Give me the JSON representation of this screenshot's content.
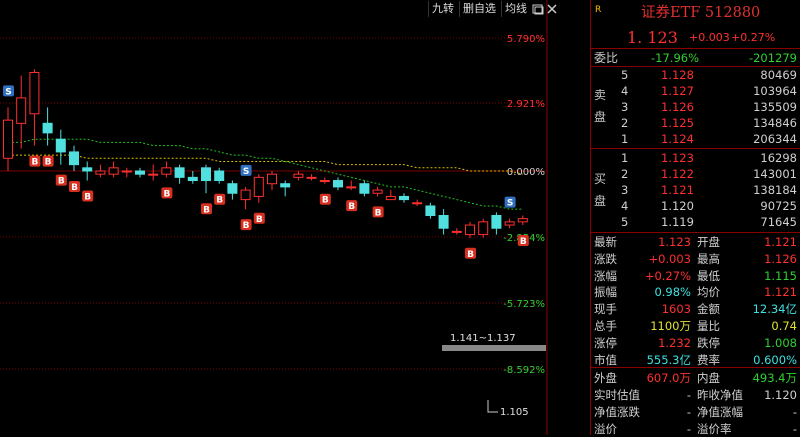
{
  "toolbar": {
    "items": [
      "九转",
      "删自选",
      "均线"
    ]
  },
  "chart_data": {
    "type": "candlestick",
    "title": "",
    "y_axis_right_labels": [
      "5.790%",
      "2.921%",
      "0.000%",
      "-2.854%",
      "-5.723%",
      "-8.592%"
    ],
    "base_price": 1.12,
    "candles": [
      {
        "o": 1.124,
        "c": 1.136,
        "h": 1.14,
        "l": 1.12
      },
      {
        "o": 1.135,
        "c": 1.143,
        "h": 1.15,
        "l": 1.127
      },
      {
        "o": 1.138,
        "c": 1.151,
        "h": 1.152,
        "l": 1.128
      },
      {
        "o": 1.135,
        "c": 1.132,
        "h": 1.14,
        "l": 1.128
      },
      {
        "o": 1.13,
        "c": 1.126,
        "h": 1.133,
        "l": 1.122
      },
      {
        "o": 1.126,
        "c": 1.122,
        "h": 1.128,
        "l": 1.12
      },
      {
        "o": 1.121,
        "c": 1.12,
        "h": 1.123,
        "l": 1.117
      },
      {
        "o": 1.119,
        "c": 1.12,
        "h": 1.122,
        "l": 1.118
      },
      {
        "o": 1.119,
        "c": 1.121,
        "h": 1.123,
        "l": 1.118
      },
      {
        "o": 1.12,
        "c": 1.12,
        "h": 1.121,
        "l": 1.118
      },
      {
        "o": 1.12,
        "c": 1.119,
        "h": 1.121,
        "l": 1.118
      },
      {
        "o": 1.119,
        "c": 1.119,
        "h": 1.122,
        "l": 1.117
      },
      {
        "o": 1.119,
        "c": 1.121,
        "h": 1.123,
        "l": 1.118
      },
      {
        "o": 1.121,
        "c": 1.118,
        "h": 1.122,
        "l": 1.116
      },
      {
        "o": 1.118,
        "c": 1.117,
        "h": 1.12,
        "l": 1.116
      },
      {
        "o": 1.121,
        "c": 1.117,
        "h": 1.122,
        "l": 1.113
      },
      {
        "o": 1.12,
        "c": 1.117,
        "h": 1.121,
        "l": 1.116
      },
      {
        "o": 1.116,
        "c": 1.113,
        "h": 1.117,
        "l": 1.111
      },
      {
        "o": 1.111,
        "c": 1.114,
        "h": 1.115,
        "l": 1.108
      },
      {
        "o": 1.112,
        "c": 1.118,
        "h": 1.119,
        "l": 1.11
      },
      {
        "o": 1.116,
        "c": 1.119,
        "h": 1.12,
        "l": 1.114
      },
      {
        "o": 1.116,
        "c": 1.115,
        "h": 1.117,
        "l": 1.112
      },
      {
        "o": 1.118,
        "c": 1.119,
        "h": 1.12,
        "l": 1.117
      },
      {
        "o": 1.118,
        "c": 1.118,
        "h": 1.119,
        "l": 1.117
      },
      {
        "o": 1.117,
        "c": 1.117,
        "h": 1.118,
        "l": 1.116
      },
      {
        "o": 1.117,
        "c": 1.115,
        "h": 1.118,
        "l": 1.114
      },
      {
        "o": 1.115,
        "c": 1.115,
        "h": 1.117,
        "l": 1.114
      },
      {
        "o": 1.116,
        "c": 1.113,
        "h": 1.117,
        "l": 1.112
      },
      {
        "o": 1.113,
        "c": 1.114,
        "h": 1.115,
        "l": 1.112
      },
      {
        "o": 1.111,
        "c": 1.112,
        "h": 1.114,
        "l": 1.111
      },
      {
        "o": 1.112,
        "c": 1.111,
        "h": 1.113,
        "l": 1.11
      },
      {
        "o": 1.11,
        "c": 1.11,
        "h": 1.111,
        "l": 1.109
      },
      {
        "o": 1.109,
        "c": 1.106,
        "h": 1.11,
        "l": 1.105
      },
      {
        "o": 1.106,
        "c": 1.102,
        "h": 1.108,
        "l": 1.1
      },
      {
        "o": 1.101,
        "c": 1.101,
        "h": 1.102,
        "l": 1.1
      },
      {
        "o": 1.1,
        "c": 1.103,
        "h": 1.104,
        "l": 1.099
      },
      {
        "o": 1.1,
        "c": 1.104,
        "h": 1.105,
        "l": 1.099
      },
      {
        "o": 1.106,
        "c": 1.102,
        "h": 1.107,
        "l": 1.1
      },
      {
        "o": 1.103,
        "c": 1.104,
        "h": 1.105,
        "l": 1.102
      },
      {
        "o": 1.104,
        "c": 1.105,
        "h": 1.106,
        "l": 1.103
      }
    ],
    "ma_green": [
      1.129,
      1.129,
      1.13,
      1.13,
      1.13,
      1.13,
      1.13,
      1.129,
      1.129,
      1.129,
      1.129,
      1.128,
      1.128,
      1.128,
      1.127,
      1.127,
      1.126,
      1.125,
      1.125,
      1.124,
      1.124,
      1.123,
      1.122,
      1.121,
      1.12,
      1.119,
      1.118,
      1.117,
      1.116,
      1.115,
      1.115,
      1.114,
      1.113,
      1.112,
      1.111,
      1.11,
      1.109,
      1.109,
      1.108,
      1.108
    ],
    "ma_yellow": [
      1.125,
      1.125,
      1.125,
      1.125,
      1.125,
      1.125,
      1.124,
      1.124,
      1.124,
      1.124,
      1.124,
      1.124,
      1.124,
      1.124,
      1.124,
      1.124,
      1.123,
      1.123,
      1.123,
      1.123,
      1.123,
      1.123,
      1.123,
      1.123,
      1.123,
      1.122,
      1.122,
      1.122,
      1.122,
      1.122,
      1.122,
      1.121,
      1.121,
      1.121,
      1.121,
      1.12,
      1.12,
      1.12,
      1.12,
      1.119
    ],
    "signals": [
      {
        "i": 0,
        "t": "S"
      },
      {
        "i": 2,
        "t": "B"
      },
      {
        "i": 3,
        "t": "B"
      },
      {
        "i": 4,
        "t": "B"
      },
      {
        "i": 5,
        "t": "B"
      },
      {
        "i": 6,
        "t": "B"
      },
      {
        "i": 12,
        "t": "B"
      },
      {
        "i": 15,
        "t": "B"
      },
      {
        "i": 16,
        "t": "B"
      },
      {
        "i": 18,
        "t": "B"
      },
      {
        "i": 18,
        "t": "S"
      },
      {
        "i": 19,
        "t": "B"
      },
      {
        "i": 24,
        "t": "B"
      },
      {
        "i": 26,
        "t": "B"
      },
      {
        "i": 28,
        "t": "B"
      },
      {
        "i": 35,
        "t": "B"
      },
      {
        "i": 39,
        "t": "B"
      },
      {
        "i": 38,
        "t": "S"
      }
    ],
    "annotations": {
      "range_label": "1.141~1.137",
      "low_label": "1.105"
    }
  },
  "quote": {
    "r_label": "R",
    "title": "证券ETF 512880",
    "price": "1. 123",
    "change": "+0.003",
    "pct": "+0.27%",
    "weibi_label": "委比",
    "weibi_pct": "-17.96%",
    "weibi_diff": "-201279",
    "sell_label": "卖盘",
    "buy_label": "买盘",
    "sell": [
      {
        "n": "5",
        "p": "1.128",
        "v": "80469"
      },
      {
        "n": "4",
        "p": "1.127",
        "v": "103964"
      },
      {
        "n": "3",
        "p": "1.126",
        "v": "135509"
      },
      {
        "n": "2",
        "p": "1.125",
        "v": "134846"
      },
      {
        "n": "1",
        "p": "1.124",
        "v": "206344"
      }
    ],
    "buy": [
      {
        "n": "1",
        "p": "1.123",
        "v": "16298"
      },
      {
        "n": "2",
        "p": "1.122",
        "v": "143001"
      },
      {
        "n": "3",
        "p": "1.121",
        "v": "138184"
      },
      {
        "n": "4",
        "p": "1.120",
        "v": "90725"
      },
      {
        "n": "5",
        "p": "1.119",
        "v": "71645"
      }
    ],
    "stats": [
      {
        "l1": "最新",
        "v1": "1.123",
        "c1": "red",
        "l2": "开盘",
        "v2": "1.121",
        "c2": "red"
      },
      {
        "l1": "涨跌",
        "v1": "+0.003",
        "c1": "red",
        "l2": "最高",
        "v2": "1.126",
        "c2": "red"
      },
      {
        "l1": "涨幅",
        "v1": "+0.27%",
        "c1": "red",
        "l2": "最低",
        "v2": "1.115",
        "c2": "grn"
      },
      {
        "l1": "振幅",
        "v1": "0.98%",
        "c1": "cy",
        "l2": "均价",
        "v2": "1.121",
        "c2": "red"
      },
      {
        "l1": "现手",
        "v1": "1603",
        "c1": "red",
        "l2": "金额",
        "v2": "12.34亿",
        "c2": "cy"
      },
      {
        "l1": "总手",
        "v1": "1100万",
        "c1": "yel",
        "l2": "量比",
        "v2": "0.74",
        "c2": "yel"
      },
      {
        "l1": "涨停",
        "v1": "1.232",
        "c1": "red",
        "l2": "跌停",
        "v2": "1.008",
        "c2": "grn"
      },
      {
        "l1": "市值",
        "v1": "555.3亿",
        "c1": "cy",
        "l2": "费率",
        "v2": "0.600%",
        "c2": "cy"
      },
      {
        "l1": "外盘",
        "v1": "607.0万",
        "c1": "red",
        "l2": "内盘",
        "v2": "493.4万",
        "c2": "grn"
      },
      {
        "l1": "实时估值",
        "v1": "-",
        "c1": "wht",
        "l2": "昨收净值",
        "v2": "1.120",
        "c2": "wht"
      },
      {
        "l1": "净值涨跌",
        "v1": "-",
        "c1": "wht",
        "l2": "净值涨幅",
        "v2": "-",
        "c2": "wht"
      },
      {
        "l1": "溢价",
        "v1": "-",
        "c1": "wht",
        "l2": "溢价率",
        "v2": "-",
        "c2": "wht"
      }
    ]
  }
}
